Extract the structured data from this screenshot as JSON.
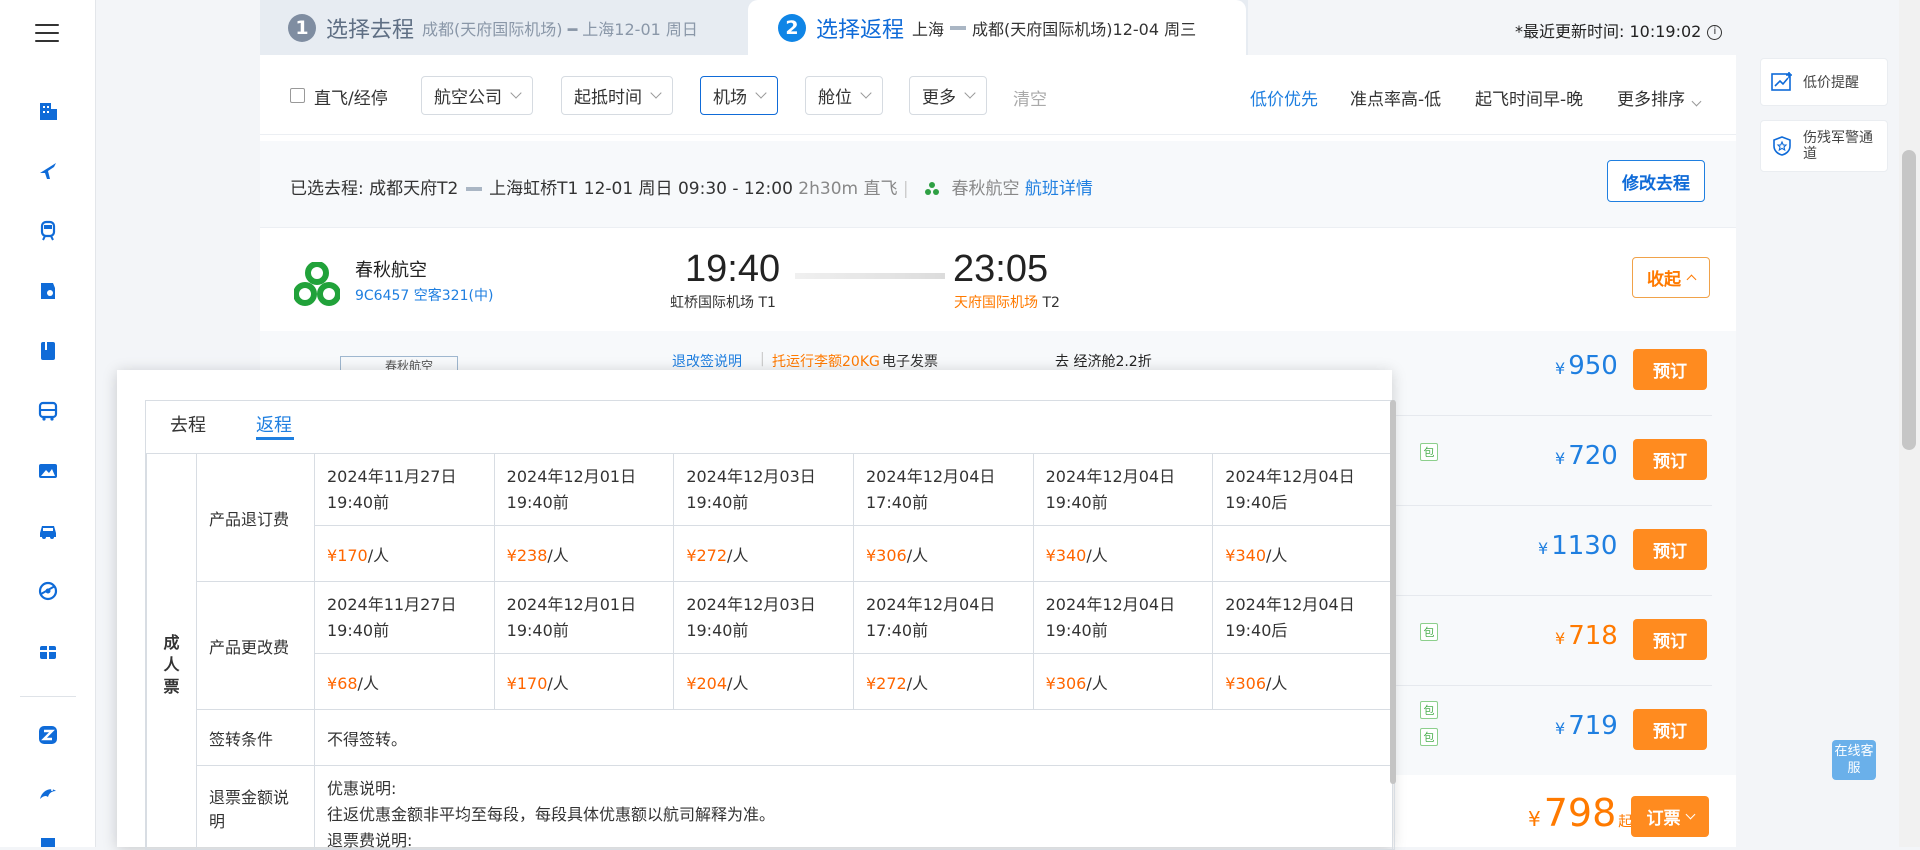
{
  "nav": {
    "items": [
      "hotel-icon",
      "flight-icon",
      "train-icon",
      "ticket-icon",
      "guide-icon",
      "bus-icon",
      "photo-icon",
      "car-icon",
      "globe-icon",
      "gift-icon",
      "zhixing-icon",
      "dolphin-icon"
    ]
  },
  "steps": {
    "one": {
      "num": "1",
      "title": "选择去程",
      "route": "成都(天府国际机场) ━ 上海12-01 周日"
    },
    "two": {
      "num": "2",
      "title": "选择返程",
      "route_pre": "上海",
      "route_post": "成都(天府国际机场)12-04 周三"
    }
  },
  "updated": {
    "label": "*最近更新时间: 10:19:02"
  },
  "filters": {
    "direct": "直飞/经停",
    "airline": "航空公司",
    "time": "起抵时间",
    "airport": "机场",
    "cabin": "舱位",
    "more": "更多",
    "clear": "清空"
  },
  "sorts": {
    "low_price": "低价优先",
    "punctuality": "准点率高-低",
    "departure": "起飞时间早-晚",
    "more_sort": "更多排序"
  },
  "selected": {
    "prefix": "已选去程:",
    "route_a": "成都天府T2",
    "route_b": "上海虹桥T1 12-01 周日 09:30 - 12:00",
    "duration": "2h30m",
    "direct": "直飞",
    "airline": "春秋航空",
    "details": "航班详情",
    "modify": "修改去程"
  },
  "flight": {
    "airline": "春秋航空",
    "flight_no": "9C6457 空客321(中)",
    "dep_time": "19:40",
    "arr_time": "23:05",
    "dep_airport": "虹桥国际机场 T1",
    "arr_airport": "天府国际机场",
    "arr_terminal": "T2",
    "collapse": "收起"
  },
  "peek": {
    "rules": "退改签说明",
    "baggage": "托运行李额20KG",
    "invoice": "电子发票",
    "cabin": "去  经济舱2.2折",
    "logo_text": "春秋航空",
    "tag": "包"
  },
  "offers": [
    {
      "currency": "¥",
      "price": "950",
      "btn": "预订"
    },
    {
      "currency": "¥",
      "price": "720",
      "btn": "预订"
    },
    {
      "currency": "¥",
      "price": "1130",
      "btn": "预订"
    },
    {
      "currency": "¥",
      "price": "718",
      "btn": "预订"
    },
    {
      "currency": "¥",
      "price": "719",
      "btn": "预订"
    }
  ],
  "bottom_offer": {
    "currency": "¥",
    "price": "798",
    "suffix": "起",
    "btn": "订票"
  },
  "side": {
    "price_alert": "低价提醒",
    "military": "伤残军警通道",
    "cs": "在线客服"
  },
  "popup": {
    "tab_go": "去程",
    "tab_return": "返程",
    "category": "成人票",
    "refund_label": "产品退订费",
    "change_label": "产品更改费",
    "endorse_label": "签转条件",
    "endorse_value": "不得签转。",
    "refund_amount_label": "退票金额说明",
    "note_1": "优惠说明:",
    "note_2": "往返优惠金额非平均至每段，每段具体优惠额以航司解释为准。",
    "note_3": "退票费说明:",
    "refund_times": [
      "2024年11月27日19:40前",
      "2024年12月01日19:40前",
      "2024年12月03日19:40前",
      "2024年12月04日17:40前",
      "2024年12月04日19:40前",
      "2024年12月04日19:40后"
    ],
    "refund_fees": [
      "170",
      "238",
      "272",
      "306",
      "340",
      "340"
    ],
    "change_times": [
      "2024年11月27日19:40前",
      "2024年12月01日19:40前",
      "2024年12月03日19:40前",
      "2024年12月04日17:40前",
      "2024年12月04日19:40前",
      "2024年12月04日19:40后"
    ],
    "change_fees": [
      "68",
      "170",
      "204",
      "272",
      "306",
      "306"
    ],
    "currency": "¥",
    "per": "/人"
  }
}
